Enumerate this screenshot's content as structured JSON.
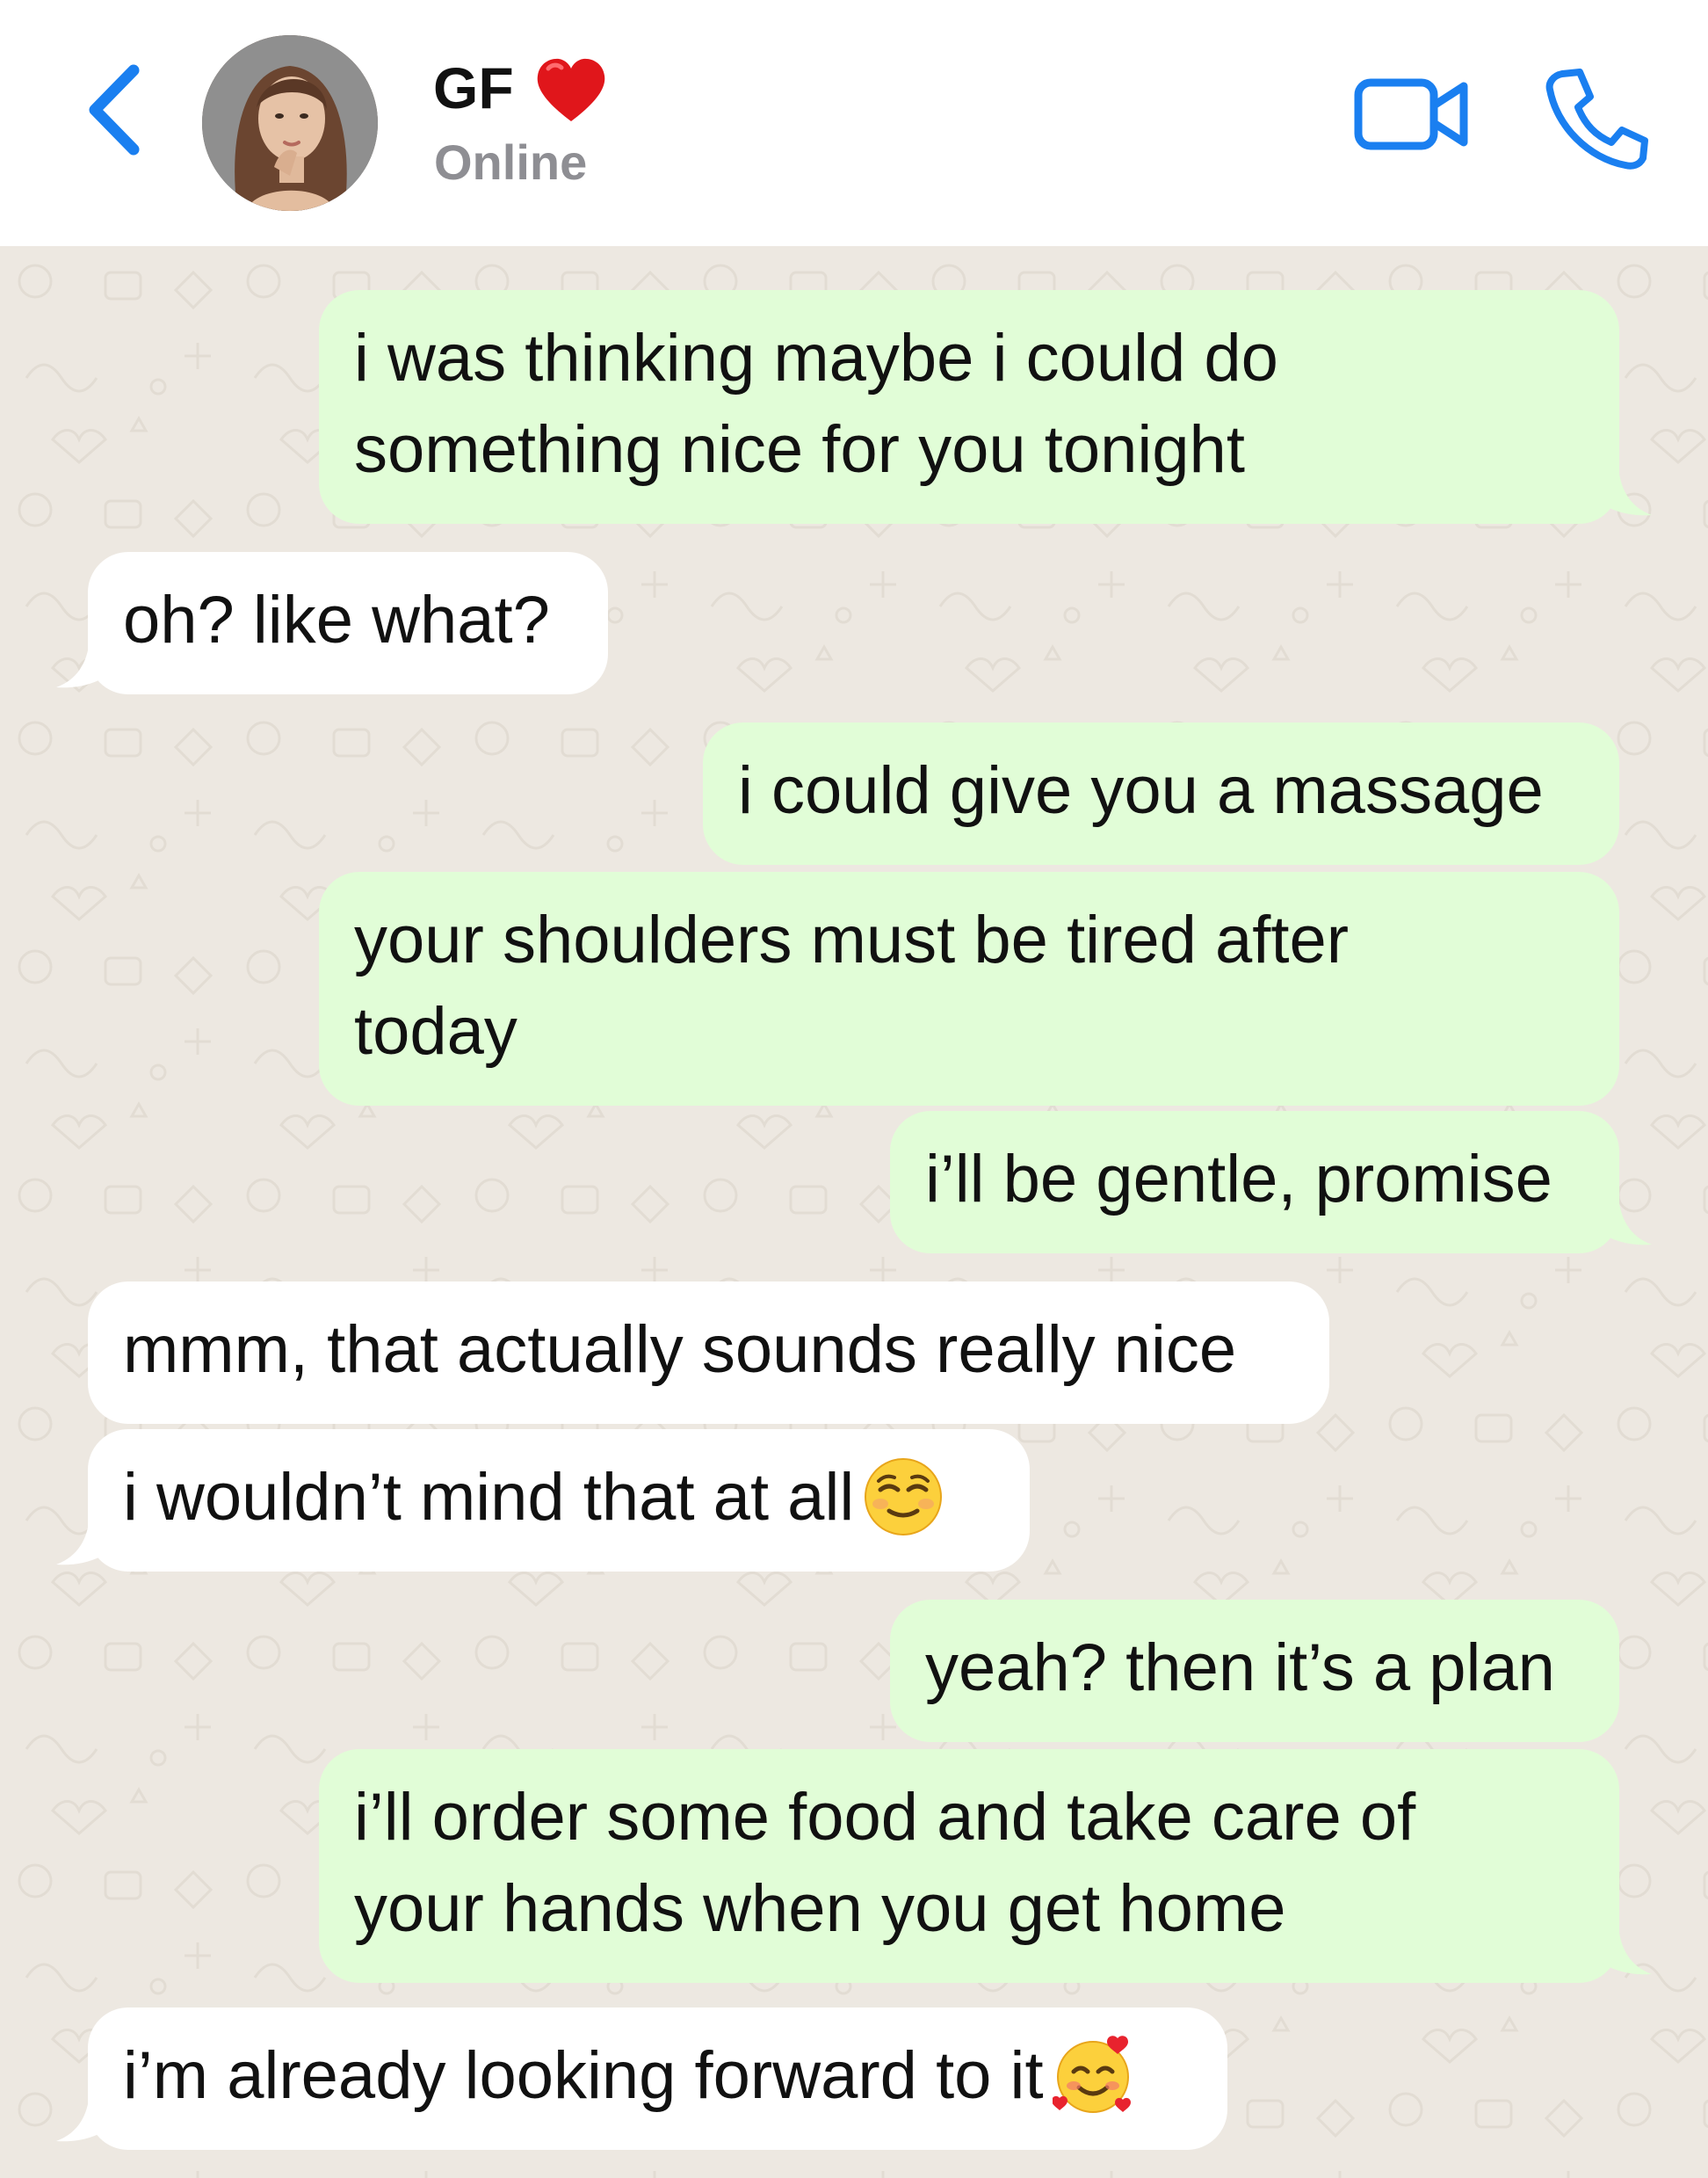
{
  "header": {
    "contact_name": "GF",
    "status": "Online",
    "icons": {
      "back": "chevron-left-icon",
      "heart": "red-heart-emoji",
      "video": "video-camera-icon",
      "call": "phone-icon"
    },
    "accent_color": "#1a7ff0"
  },
  "colors": {
    "outgoing_bubble": "#e1fdd7",
    "incoming_bubble": "#ffffff",
    "chat_background": "#ede8e1"
  },
  "messages": [
    {
      "direction": "outgoing",
      "lines": [
        "i was thinking maybe i could do",
        "something nice for you tonight"
      ]
    },
    {
      "direction": "incoming",
      "lines": [
        "oh? like what?"
      ]
    },
    {
      "direction": "outgoing",
      "lines": [
        "i could give you a massage"
      ]
    },
    {
      "direction": "outgoing",
      "lines": [
        "your shoulders must be tired after",
        "today"
      ]
    },
    {
      "direction": "outgoing",
      "lines": [
        "i’ll be gentle, promise"
      ]
    },
    {
      "direction": "incoming",
      "lines": [
        "mmm, that actually sounds really nice"
      ]
    },
    {
      "direction": "incoming",
      "lines": [
        "i wouldn’t mind that at all"
      ],
      "emoji": "relieved-face-emoji"
    },
    {
      "direction": "outgoing",
      "lines": [
        "yeah? then it’s a plan"
      ]
    },
    {
      "direction": "outgoing",
      "lines": [
        "i’ll order some food and take care of",
        "your hands when you get home"
      ]
    },
    {
      "direction": "incoming",
      "lines": [
        "i’m already looking forward to it"
      ],
      "emoji": "smiling-face-with-hearts-emoji"
    }
  ]
}
